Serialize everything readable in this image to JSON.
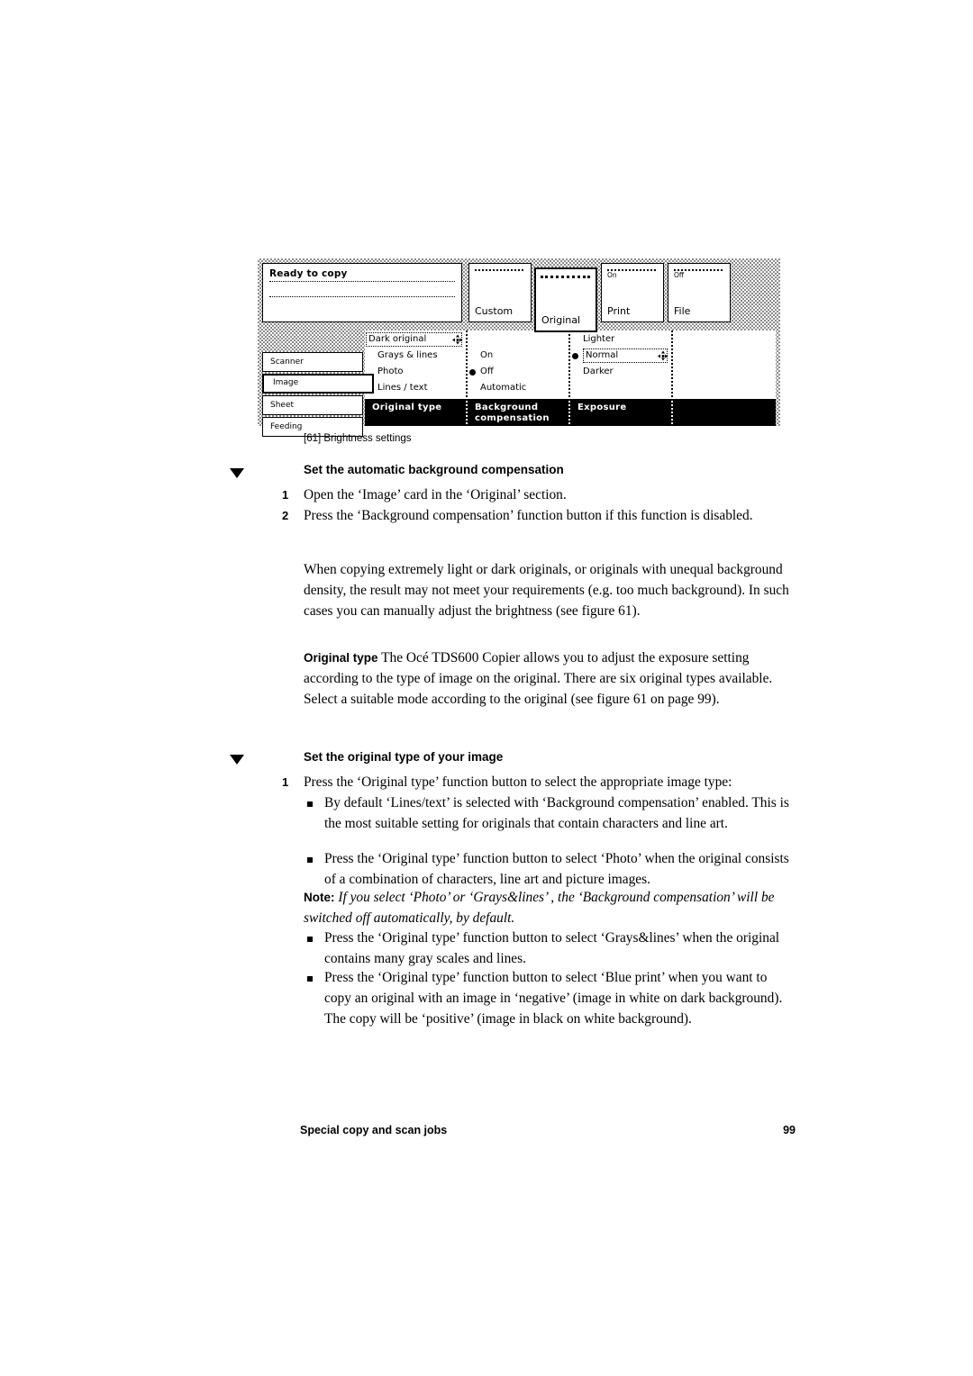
{
  "figure": {
    "caption": "[61] Brightness settings",
    "panel": {
      "status": {
        "title": "Ready to copy"
      },
      "tabs": [
        {
          "name": "custom",
          "sub": "",
          "label": "Custom",
          "selected": false
        },
        {
          "name": "original",
          "sub": "",
          "label": "Original",
          "selected": true
        },
        {
          "name": "print",
          "sub": "On",
          "label": "Print",
          "selected": false
        },
        {
          "name": "file",
          "sub": "Off",
          "label": "File",
          "selected": false
        }
      ],
      "sidebar": [
        {
          "label": "Scanner",
          "selected": false
        },
        {
          "label": "Image",
          "selected": true
        },
        {
          "label": "Sheet",
          "selected": false
        },
        {
          "label": "Feeding",
          "selected": false
        }
      ],
      "columns": [
        {
          "function_label": "Original type",
          "options": [
            {
              "label": "Dark original",
              "selected": false,
              "boxed": true,
              "stepper": true
            },
            {
              "label": "Grays & lines",
              "selected": false,
              "boxed": false,
              "stepper": false
            },
            {
              "label": "Photo",
              "selected": false,
              "boxed": false,
              "stepper": false
            },
            {
              "label": "Lines / text",
              "selected": true,
              "boxed": false,
              "stepper": false
            }
          ]
        },
        {
          "function_label": "Background compensation",
          "function_label_line1": "Background",
          "function_label_line2": "compensation",
          "options": [
            {
              "label": "",
              "selected": false,
              "boxed": false,
              "stepper": false
            },
            {
              "label": "On",
              "selected": false,
              "boxed": false,
              "stepper": false
            },
            {
              "label": "Off",
              "selected": true,
              "boxed": false,
              "stepper": false
            },
            {
              "label": "Automatic",
              "selected": false,
              "boxed": false,
              "stepper": false
            }
          ]
        },
        {
          "function_label": "Exposure",
          "options": [
            {
              "label": "Lighter",
              "selected": false,
              "boxed": false,
              "stepper": false
            },
            {
              "label": "Normal",
              "selected": true,
              "boxed": true,
              "stepper": true
            },
            {
              "label": "Darker",
              "selected": false,
              "boxed": false,
              "stepper": false
            }
          ]
        },
        {
          "function_label": "",
          "options": []
        }
      ]
    }
  },
  "sections": [
    {
      "heading": "Set the automatic background compensation",
      "steps": [
        {
          "num": "1",
          "text": "Open the ‘Image’ card in the ‘Original’ section."
        },
        {
          "num": "2",
          "text": "Press the ‘Background compensation’ function button if this function is disabled."
        }
      ],
      "paragraph": "When copying extremely light or dark originals, or originals with unequal background density, the result may not meet your requirements (e.g. too much background). In such cases you can manually adjust the brightness  (see figure 61).",
      "paragraph2_bold": "Original type",
      "paragraph2": " The Océ TDS600 Copier allows you to adjust the exposure setting according to the type of image on the original. There are six original types available. Select a suitable mode according to the original (see figure 61 on page 99)."
    },
    {
      "heading": "Set the original type of your image",
      "steps": [
        {
          "num": "1",
          "text": "Press the ‘Original type’ function button to select the appropriate image type:"
        }
      ],
      "bullets": [
        "By default ‘Lines/text’ is selected with ‘Background compensation’ enabled. This is the most suitable setting for originals that contain characters and line art.",
        "Press the ‘Original type’ function button to select ‘Photo’ when the original consists of a combination of characters, line art and picture images."
      ],
      "note_label": "Note:",
      "note_text": " If you select ‘Photo’ or ‘Grays&lines’ , the ‘Background compensation’ will be switched off automatically, by default.",
      "bullets2": [
        "Press the ‘Original type’ function button to select ‘Grays&lines’ when the original contains many gray scales and lines.",
        "Press the ‘Original type’ function button to select ‘Blue print’ when you want to copy an original with an image in ‘negative’ (image in white on dark background). The copy will be ‘positive’ (image in black on white background)."
      ]
    }
  ],
  "footer": {
    "chapter": "Special copy and scan jobs",
    "page_number": "99"
  }
}
